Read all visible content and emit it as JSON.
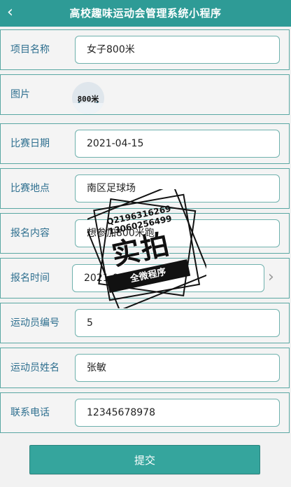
{
  "header": {
    "title": "高校趣味运动会管理系统小程序",
    "back_icon": "chevron-left-icon"
  },
  "form": {
    "fields": [
      {
        "label": "项目名称",
        "value": "女子800米"
      },
      {
        "label": "图片",
        "image_text": "800米"
      },
      {
        "label": "比赛日期",
        "value": "2021-04-15"
      },
      {
        "label": "比赛地点",
        "value": "南区足球场"
      },
      {
        "label": "报名内容",
        "value": "想参加800米跑"
      },
      {
        "label": "报名时间",
        "value": "2021-04-07",
        "icon": "chevron-right-icon"
      },
      {
        "label": "运动员编号",
        "value": "5"
      },
      {
        "label": "运动员姓名",
        "value": "张敏"
      },
      {
        "label": "联系电话",
        "value": "12345678978"
      }
    ],
    "submit_label": "提交"
  },
  "watermark": {
    "line1": "Q2196316269",
    "line2": "13060256499",
    "big_text": "实拍",
    "ribbon_text": "全微程序"
  },
  "colors": {
    "accent": "#2e9b96",
    "label": "#2e6f8f",
    "border": "#5aa7a3"
  }
}
